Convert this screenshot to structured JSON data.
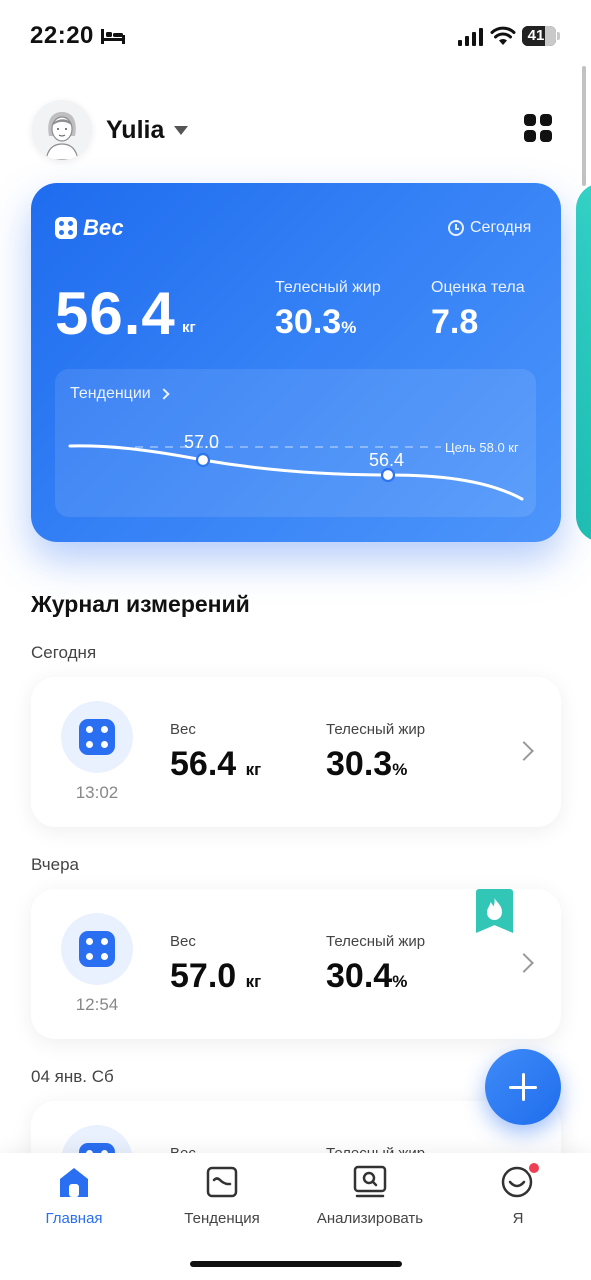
{
  "status_bar": {
    "time": "22:20",
    "battery_level": "41",
    "icons": [
      "bed-icon",
      "signal-icon",
      "wifi-icon",
      "battery-icon"
    ]
  },
  "header": {
    "user_name": "Yulia",
    "icons": [
      "avatar",
      "dropdown-caret-icon",
      "apps-grid-icon"
    ]
  },
  "weight_card": {
    "title": "Вес",
    "date": "Сегодня",
    "weight": "56.4",
    "weight_unit": "кг",
    "body_fat_label": "Телесный жир",
    "body_fat": "30.3",
    "body_fat_unit": "%",
    "body_score_label": "Оценка тела",
    "body_score": "7.8",
    "trend_label": "Тенденции",
    "goal_label": "Цель 58.0 кг",
    "trend_points": [
      {
        "label": "57.0"
      },
      {
        "label": "56.4"
      }
    ],
    "colors": {
      "card": "#2a75f1",
      "peek": "#2cc9b9"
    }
  },
  "log": {
    "title": "Журнал измерений",
    "groups": [
      {
        "day": "Сегодня",
        "time": "13:02",
        "weight_label": "Вес",
        "weight": "56.4",
        "weight_unit": "кг",
        "fat_label": "Телесный жир",
        "fat": "30.3",
        "fat_unit": "%"
      },
      {
        "day": "Вчера",
        "time": "12:54",
        "weight_label": "Вес",
        "weight": "57.0",
        "weight_unit": "кг",
        "fat_label": "Телесный жир",
        "fat": "30.4",
        "fat_unit": "%"
      },
      {
        "day": "04 янв. Сб",
        "weight_label": "Вес",
        "fat_label": "Телесный жир"
      }
    ]
  },
  "nav": {
    "items": [
      {
        "label": "Главная",
        "icon": "home-icon",
        "active": true
      },
      {
        "label": "Тенденция",
        "icon": "trend-icon"
      },
      {
        "label": "Анализировать",
        "icon": "analyze-icon"
      },
      {
        "label": "Я",
        "icon": "profile-icon"
      }
    ],
    "accent": "#2a6ff1"
  }
}
